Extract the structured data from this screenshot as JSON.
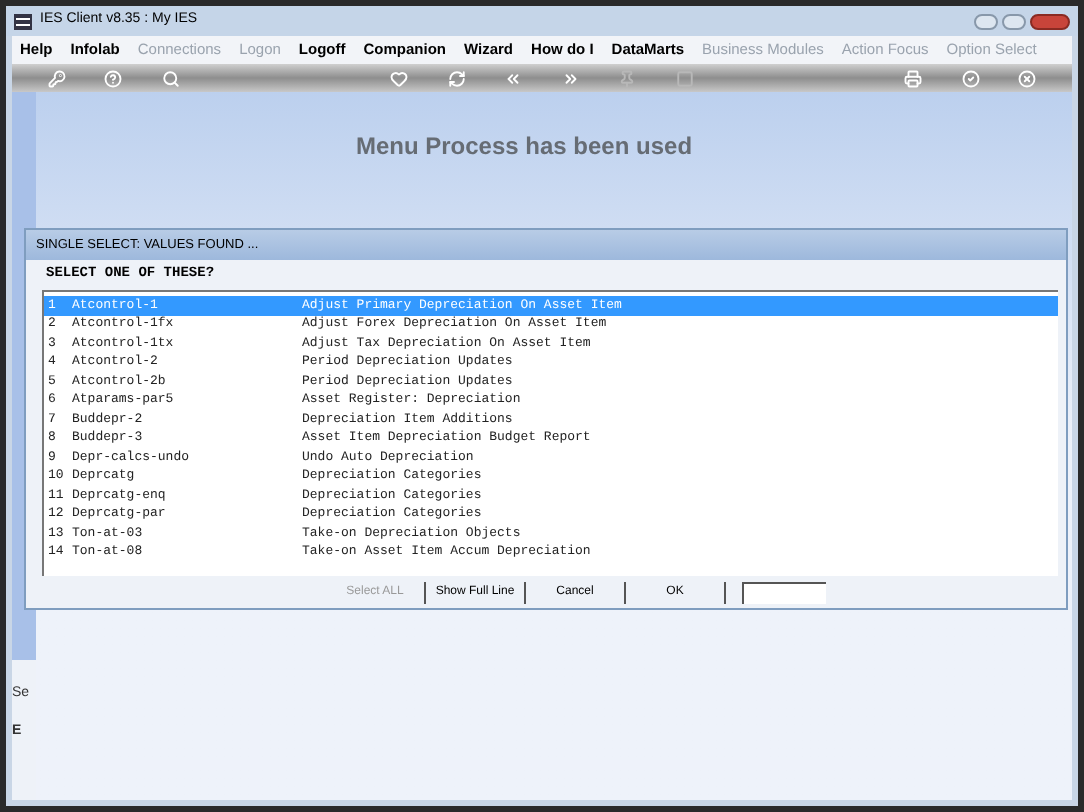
{
  "window": {
    "title": "IES Client v8.35 : My IES"
  },
  "menu": [
    {
      "label": "Help",
      "disabled": false
    },
    {
      "label": "Infolab",
      "disabled": false
    },
    {
      "label": "Connections",
      "disabled": true
    },
    {
      "label": "Logon",
      "disabled": true
    },
    {
      "label": "Logoff",
      "disabled": false
    },
    {
      "label": "Companion",
      "disabled": false
    },
    {
      "label": "Wizard",
      "disabled": false
    },
    {
      "label": "How do I",
      "disabled": false
    },
    {
      "label": "DataMarts",
      "disabled": false
    },
    {
      "label": "Business Modules",
      "disabled": true
    },
    {
      "label": "Action Focus",
      "disabled": true
    },
    {
      "label": "Option Select",
      "disabled": true
    }
  ],
  "toolbar": [
    {
      "kind": "key",
      "disabled": false
    },
    {
      "kind": "help",
      "disabled": false
    },
    {
      "kind": "search",
      "disabled": false
    },
    {
      "kind": "spacer"
    },
    {
      "kind": "heart",
      "disabled": false
    },
    {
      "kind": "refresh",
      "disabled": false
    },
    {
      "kind": "back",
      "disabled": false
    },
    {
      "kind": "forward",
      "disabled": false
    },
    {
      "kind": "pin",
      "disabled": true
    },
    {
      "kind": "stop",
      "disabled": true
    },
    {
      "kind": "spacer"
    },
    {
      "kind": "print",
      "disabled": false
    },
    {
      "kind": "check",
      "disabled": false
    },
    {
      "kind": "close",
      "disabled": false
    }
  ],
  "page": {
    "heading": "Menu Process has been used"
  },
  "dialog": {
    "title": "SINGLE SELECT: VALUES FOUND ...",
    "prompt": "SELECT ONE OF THESE?",
    "rows": [
      {
        "number": "1",
        "code": "Atcontrol-1",
        "description": "Adjust Primary Depreciation On Asset Item",
        "selected": true
      },
      {
        "number": "2",
        "code": "Atcontrol-1fx",
        "description": "Adjust Forex Depreciation On Asset Item",
        "selected": false
      },
      {
        "number": "3",
        "code": "Atcontrol-1tx",
        "description": "Adjust Tax Depreciation On Asset Item",
        "selected": false
      },
      {
        "number": "4",
        "code": "Atcontrol-2",
        "description": "Period Depreciation Updates",
        "selected": false
      },
      {
        "number": "5",
        "code": "Atcontrol-2b",
        "description": "Period Depreciation Updates",
        "selected": false
      },
      {
        "number": "6",
        "code": "Atparams-par5",
        "description": "Asset Register: Depreciation",
        "selected": false
      },
      {
        "number": "7",
        "code": "Buddepr-2",
        "description": "Depreciation Item Additions",
        "selected": false
      },
      {
        "number": "8",
        "code": "Buddepr-3",
        "description": "Asset Item Depreciation Budget Report",
        "selected": false
      },
      {
        "number": "9",
        "code": "Depr-calcs-undo",
        "description": "Undo Auto Depreciation",
        "selected": false
      },
      {
        "number": "10",
        "code": "Deprcatg",
        "description": "Depreciation Categories",
        "selected": false
      },
      {
        "number": "11",
        "code": "Deprcatg-enq",
        "description": "Depreciation Categories",
        "selected": false
      },
      {
        "number": "12",
        "code": "Deprcatg-par",
        "description": "Depreciation Categories",
        "selected": false
      },
      {
        "number": "13",
        "code": "Ton-at-03",
        "description": "Take-on Depreciation Objects",
        "selected": false
      },
      {
        "number": "14",
        "code": "Ton-at-08",
        "description": "Take-on Asset Item Accum Depreciation",
        "selected": false
      }
    ],
    "buttons": [
      {
        "label": "Select ALL",
        "disabled": true
      },
      {
        "label": "Show Full Line",
        "disabled": false
      },
      {
        "label": "Cancel",
        "disabled": false
      },
      {
        "label": "OK",
        "disabled": false
      }
    ]
  },
  "side_labels": [
    "Se",
    "E"
  ]
}
